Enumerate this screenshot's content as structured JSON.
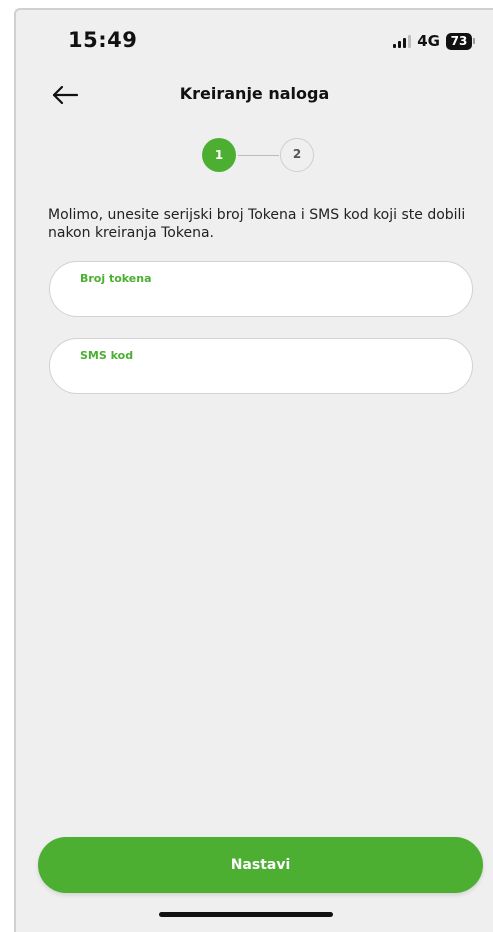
{
  "status_bar": {
    "time": "15:49",
    "network": "4G",
    "battery": "73"
  },
  "header": {
    "back_icon": "arrow-left-icon",
    "title": "Kreiranje naloga"
  },
  "stepper": {
    "current_step": 1,
    "steps": [
      "1",
      "2"
    ]
  },
  "instructions": "Molimo, unesite serijski broj Tokena i SMS kod koji ste dobili nakon kreiranja Tokena.",
  "form": {
    "token_field": {
      "label": "Broj tokena",
      "value": ""
    },
    "sms_field": {
      "label": "SMS kod",
      "value": ""
    }
  },
  "primary_button": {
    "label": "Nastavi"
  },
  "colors": {
    "accent": "#4caf32",
    "background": "#efefef",
    "field_background": "#ffffff"
  }
}
